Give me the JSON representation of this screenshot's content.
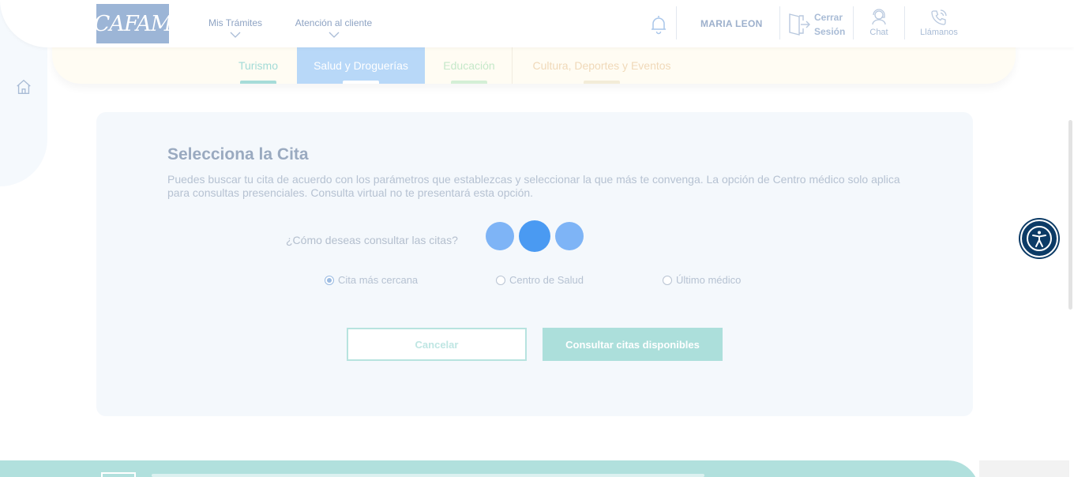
{
  "header": {
    "logo_text": "CAFAM",
    "nav": [
      {
        "label": "Mis Trámites"
      },
      {
        "label": "Atención al cliente"
      }
    ],
    "user_name": "MARIA LEON",
    "logout_line1": "Cerrar",
    "logout_line2": "Sesión",
    "chat_label": "Chat",
    "call_label": "Llámanos"
  },
  "tabs": [
    {
      "label": "Turismo"
    },
    {
      "label": "Salud y Droguerías",
      "active": true
    },
    {
      "label": "Educación"
    },
    {
      "label": "Cultura, Deportes y Eventos"
    }
  ],
  "main": {
    "title": "Selecciona la Cita",
    "description": "Puedes buscar tu cita de acuerdo con los parámetros que establezcas y seleccionar la que más te convenga. La opción de Centro médico solo aplica para consultas presenciales. Consulta virtual no te presentará esta opción.",
    "question": "¿Cómo deseas consultar las citas?",
    "options": [
      {
        "label": "Cita más cercana",
        "checked": true
      },
      {
        "label": "Centro de Salud",
        "checked": false
      },
      {
        "label": "Último médico",
        "checked": false
      }
    ],
    "cancel_label": "Cancelar",
    "submit_label": "Consultar citas disponibles"
  },
  "colors": {
    "accent_teal": "#acdfdb",
    "active_tab": "#b8d8f8",
    "loader_dot": "#4a9af2",
    "a11y_button": "#0c3b66"
  },
  "icons": [
    "home-icon",
    "bell-icon",
    "logout-icon",
    "chat-icon",
    "phone-icon",
    "accessibility-icon",
    "chevron-down-icon"
  ]
}
